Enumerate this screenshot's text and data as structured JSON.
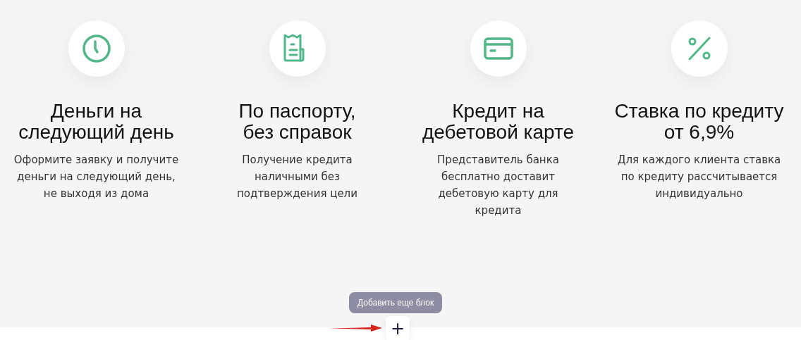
{
  "features": [
    {
      "kind": "clock",
      "title": "Деньги на\nследующий день",
      "text": "Оформите заявку и получите\nденьги на следующий день,\nне выходя из дома"
    },
    {
      "kind": "receipt",
      "title": "По паспорту,\nбез справок",
      "text": "Получение кредита\nналичными без\nподтверждения цели"
    },
    {
      "kind": "card",
      "title": "Кредит на\nдебетовой карте",
      "text": "Представитель банка\nбесплатно доставит\nдебетовую карту для\nкредита"
    },
    {
      "kind": "percent",
      "title": "Ставка по кредиту\nот 6,9%",
      "text": "Для каждого клиента ставка\nпо кредиту рассчитывается\nиндивидуально"
    }
  ],
  "tooltip": "Добавить еще блок",
  "add_button": "+"
}
